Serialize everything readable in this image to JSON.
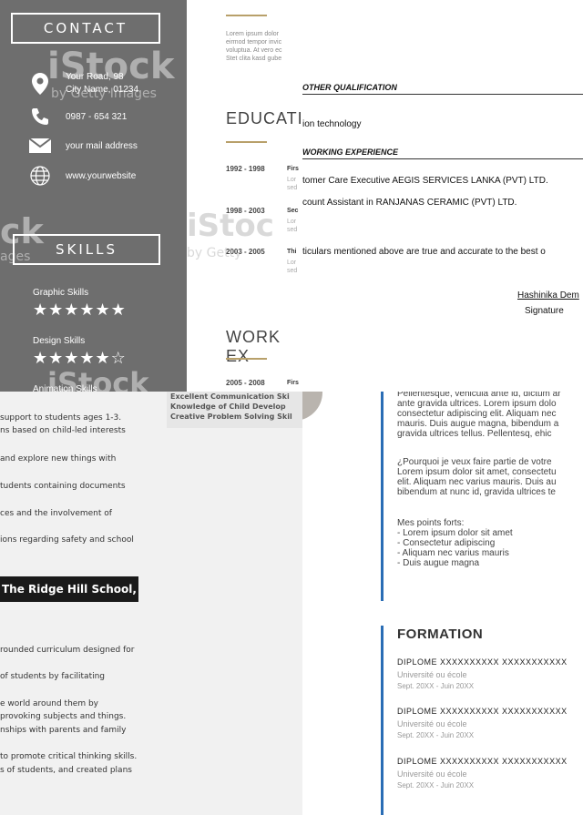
{
  "resume_a": {
    "contact_heading": "CONTACT",
    "address_line1": "Your Road, 98",
    "address_line2": "City Name, 01234",
    "phone": "0987 - 654 321",
    "email": "your mail address",
    "website": "www.yourwebsite",
    "skills_heading": "SKILLS",
    "skills": [
      {
        "label": "Graphic Skills",
        "stars": "★★★★★★"
      },
      {
        "label": "Design Skills",
        "stars": "★★★★★☆"
      },
      {
        "label": "Animation Skills"
      }
    ],
    "watermark": "iStock",
    "watermark_sub": "by Getty Images",
    "watermark_left": "ck",
    "watermark_left_sub": "ages"
  },
  "resume_b": {
    "about_text": [
      "Lorem ipsum dolor",
      "eirmod tempor invic",
      "voluptua. At vero ec",
      "Stet clita kasd gube"
    ],
    "education_title": "EDUCATIO",
    "entries": [
      {
        "date": "1992 - 1998",
        "title": "Firs",
        "lines": [
          "Lor",
          "sed"
        ]
      },
      {
        "date": "1998 - 2003",
        "title": "Sec",
        "lines": [
          "Lor",
          "sed"
        ]
      },
      {
        "date": "2003 - 2005",
        "title": "Thi",
        "lines": [
          "Lor",
          "sed"
        ]
      }
    ],
    "work_title": "WORK EX",
    "work_entry": {
      "date": "2005 - 2008",
      "title": "Firs"
    },
    "watermark": "iStoc",
    "watermark_sub": "by Getty"
  },
  "qualification": {
    "other_heading": "OTHER QUALIFICATION",
    "other_line": "ion technology",
    "work_heading": "WORKING EXPERIENCE",
    "work_lines": [
      "tomer Care Executive AEGIS SERVICES LANKA (PVT) LTD.",
      "count Assistant in RANJANAS CERAMIC (PVT) LTD."
    ],
    "declaration": "ticulars mentioned above are true and accurate to the best o",
    "signature_name": "Hashinika Dem",
    "signature_label": "Signature"
  },
  "teacher": {
    "lines": [
      "support to students ages 1-3.",
      "ns based on child-led interests",
      "and explore new things with",
      "tudents containing documents",
      "ces and the involvement of",
      "ions regarding safety and school"
    ],
    "school_name": "The Ridge Hill School,",
    "lines2": [
      "rounded curriculum designed for",
      "of students by facilitating",
      "e world around them by",
      "provoking subjects and things.",
      "nships with parents and family",
      "to promote critical thinking skills.",
      "s of students, and created plans"
    ],
    "skills": [
      "Excellent Communication Ski",
      "Knowledge of Child Develop",
      "Creative Problem Solving Skil"
    ]
  },
  "french": {
    "intro": [
      "Pellentesque, vehicula ante id, dictum ar",
      "ante gravida ultrices. Lorem ipsum dolo",
      "consectetur adipiscing elit. Aliquam nec",
      "mauris. Duis augue magna, bibendum a",
      "gravida ultrices tellus. Pellentesq, ehic"
    ],
    "why": [
      "¿Pourquoi je veux faire partie de votre",
      "Lorem ipsum dolor sit amet, consectetu",
      "elit. Aliquam nec varius mauris. Duis au",
      "bibendum at nunc id, gravida ultrices te"
    ],
    "points_heading": "Mes points forts:",
    "points": [
      "- Lorem ipsum dolor sit amet",
      "- Consectetur adipiscing",
      "- Aliquam nec varius mauris",
      "- Duis augue magna"
    ],
    "formation_title": "FORMATION",
    "diplomes": [
      {
        "title": "DIPLOME  XXXXXXXXXX XXXXXXXXXXX",
        "school": "Université ou école",
        "dates": "Sept. 20XX - Juin 20XX"
      },
      {
        "title": "DIPLOME  XXXXXXXXXX XXXXXXXXXXX",
        "school": "Université ou école",
        "dates": "Sept. 20XX - Juin 20XX"
      },
      {
        "title": "DIPLOME  XXXXXXXXXX XXXXXXXXXXX",
        "school": "Université ou école",
        "dates": "Sept. 20XX - Juin 20XX"
      }
    ]
  }
}
